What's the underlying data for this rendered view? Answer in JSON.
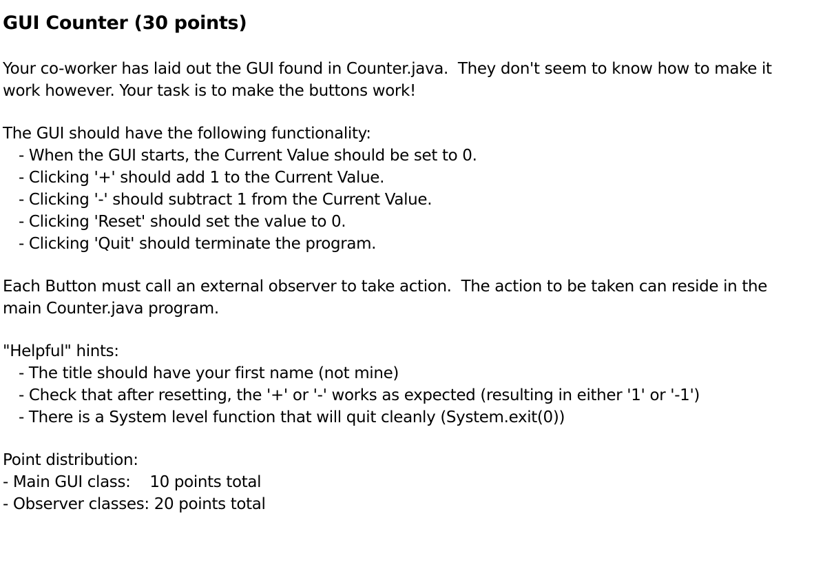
{
  "title": "GUI Counter (30 points)",
  "intro": {
    "line1": "Your co-worker has laid out the GUI found in Counter.java.  They don't seem to know how to make it",
    "line2": "work however. Your task is to make the buttons work!"
  },
  "functionality": {
    "heading": "The GUI should have the following functionality:",
    "items": [
      "- When the GUI starts, the Current Value should be set to 0.",
      "- Clicking '+' should add 1 to the Current Value.",
      "- Clicking '-' should subtract 1 from the Current Value.",
      "- Clicking 'Reset' should set the value to 0.",
      "- Clicking 'Quit' should terminate the program."
    ]
  },
  "observer": {
    "line1": "Each Button must call an external observer to take action.  The action to be taken can reside in the",
    "line2": "main Counter.java program."
  },
  "hints": {
    "heading": "\"Helpful\" hints:",
    "items": [
      "- The title should have your first name (not mine)",
      "- Check that after resetting, the '+' or '-' works as expected (resulting in either '1' or '-1')",
      "- There is a System level function that will quit cleanly (System.exit(0))"
    ]
  },
  "points": {
    "heading": "Point distribution:",
    "items": [
      "- Main GUI class:    10 points total",
      "- Observer classes: 20 points total"
    ]
  }
}
